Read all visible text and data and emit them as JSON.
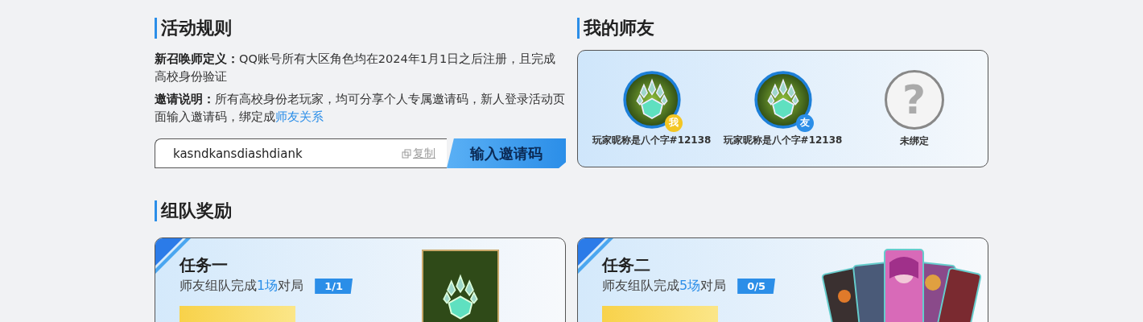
{
  "rules": {
    "title": "活动规则",
    "paragraphs": [
      {
        "lead": "新召唤师定义：",
        "text": "QQ账号所有大区角色均在2024年1月1日之后注册，且完成高校身份验证"
      },
      {
        "lead": "邀请说明：",
        "text": "所有高校身份老玩家，均可分享个人专属邀请码，新人登录活动页面输入邀请码，绑定成",
        "link": "师友关系"
      }
    ],
    "code_field": {
      "value": "kasndkansdiashdiank",
      "copy_label": "复制"
    },
    "submit_button": "输入邀请码"
  },
  "friends": {
    "title": "我的师友",
    "members": [
      {
        "kind": "bound",
        "name": "玩家昵称是八个字#12138",
        "badge": "我",
        "color": "#f3c623"
      },
      {
        "kind": "bound",
        "name": "玩家昵称是八个字#12138",
        "badge": "友",
        "color": "#2b8ee8"
      },
      {
        "kind": "empty",
        "symbol": "?",
        "name": "未绑定"
      }
    ]
  },
  "team_rewards": {
    "title": "组队奖励",
    "tasks": [
      {
        "title": "任务一",
        "desc_before": "师友组队完成",
        "highlight": "1场",
        "desc_after": "对局",
        "progress": "1/1",
        "kind": "emblem"
      },
      {
        "title": "任务二",
        "desc_before": "师友组队完成",
        "highlight": "5场",
        "desc_after": "对局",
        "progress": "0/5",
        "kind": "cards"
      }
    ]
  }
}
